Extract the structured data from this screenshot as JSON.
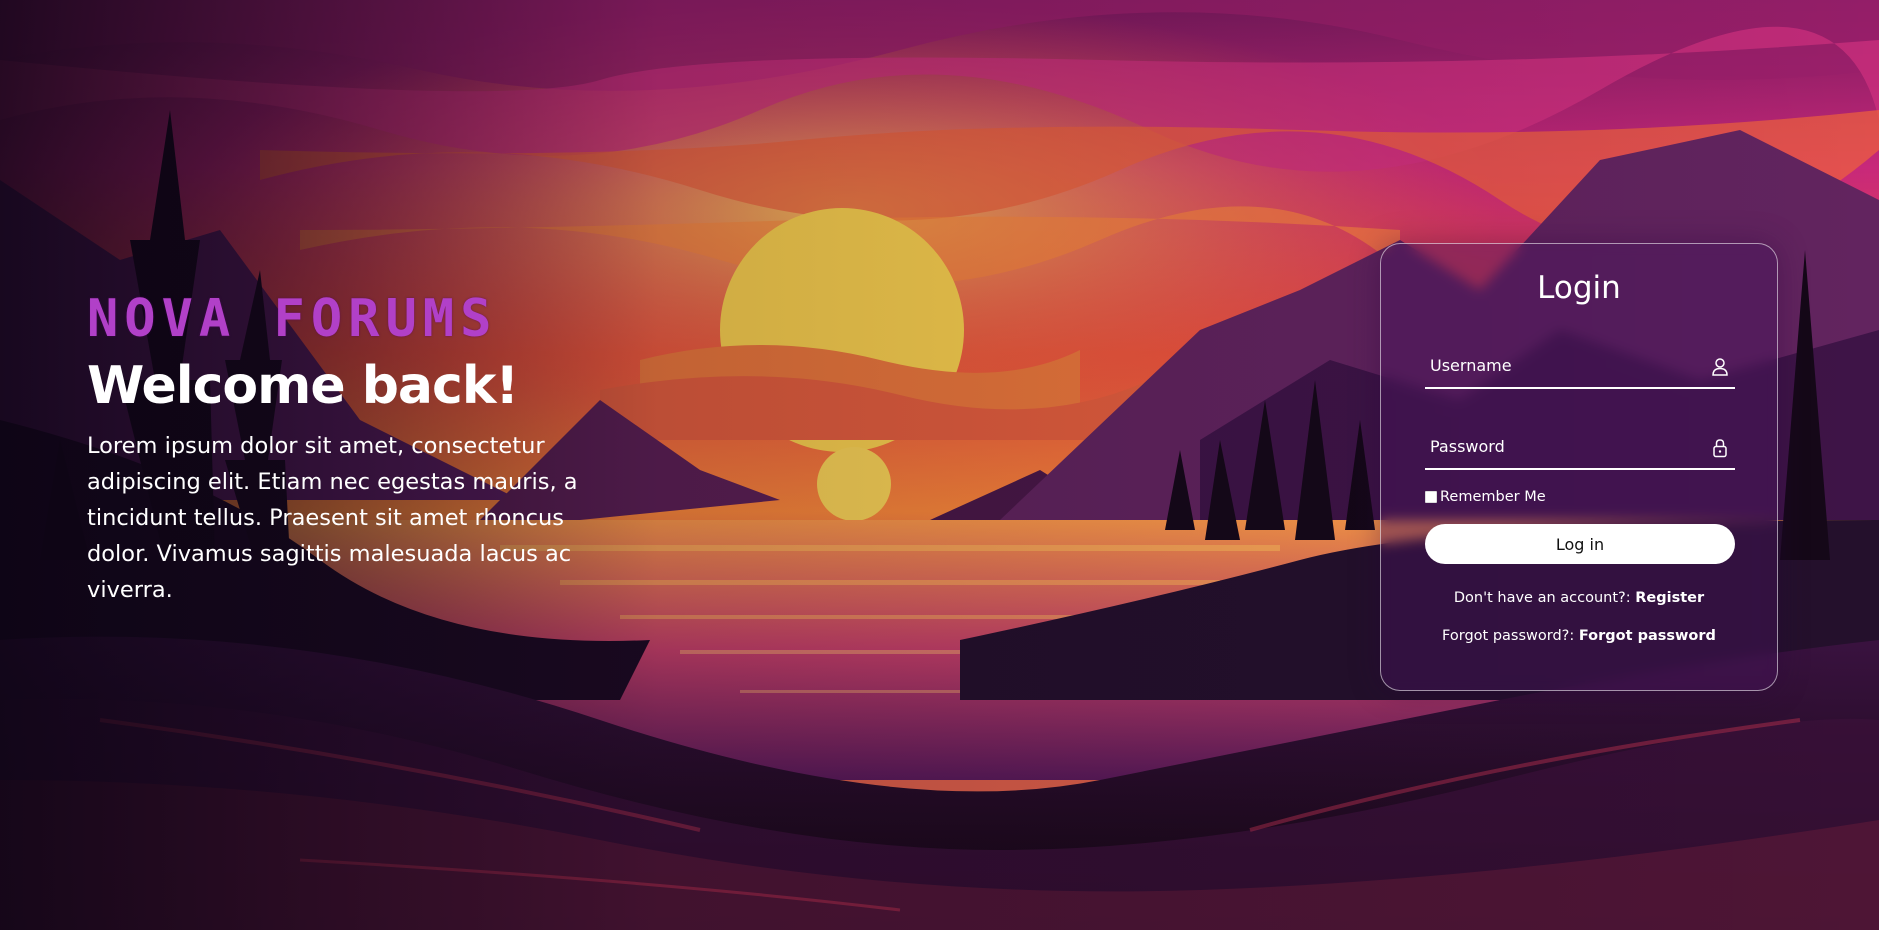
{
  "brand": {
    "logo_text": "NOVA FORUMS",
    "accent_color": "#b140c8"
  },
  "hero": {
    "title": "Welcome back!",
    "body": "Lorem ipsum dolor sit amet, consectetur adipiscing elit. Etiam nec egestas mauris, a tincidunt tellus. Praesent sit amet rhoncus dolor. Vivamus sagittis malesuada lacus ac viverra."
  },
  "login": {
    "title": "Login",
    "username": {
      "placeholder": "Username",
      "value": "",
      "icon": "user-icon"
    },
    "password": {
      "placeholder": "Password",
      "value": "",
      "icon": "lock-icon"
    },
    "remember_label": "Remember Me",
    "remember_checked": false,
    "submit_label": "Log in",
    "register_prompt": "Don't have an account?:",
    "register_link": "Register",
    "forgot_prompt": "Forgot password?:",
    "forgot_link": "Forgot password"
  },
  "background": {
    "scene": "sunset-lake-illustration"
  }
}
